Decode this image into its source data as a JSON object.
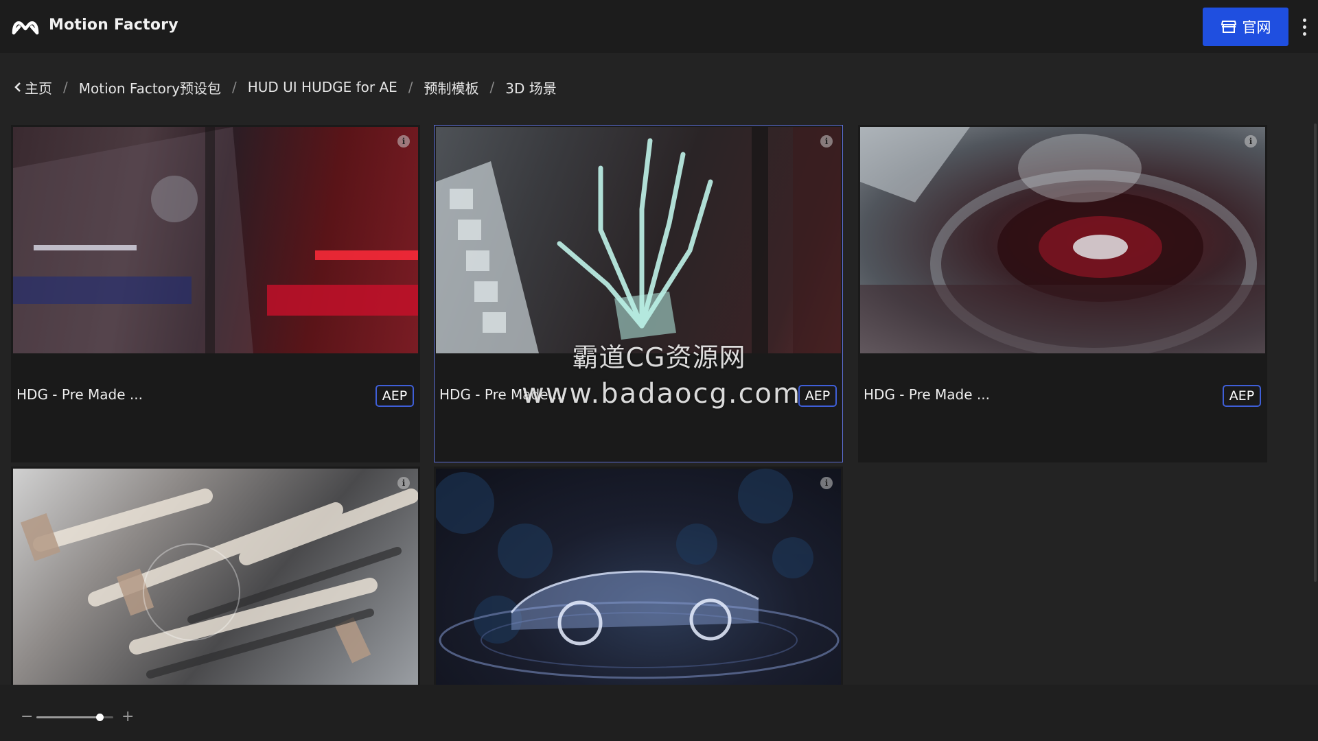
{
  "app": {
    "title": "Motion Factory",
    "logo_icon": "motion-factory-logo-icon"
  },
  "header": {
    "official_site_label": "官网",
    "official_icon": "store-icon",
    "more_icon": "more-vertical-icon"
  },
  "breadcrumb": {
    "items": [
      "主页",
      "Motion Factory预设包",
      "HUD UI HUDGE for AE",
      "预制模板",
      "3D 场景"
    ],
    "separator": "/"
  },
  "cards": [
    {
      "title": "HDG - Pre Made ...",
      "badge": "AEP",
      "info": "i"
    },
    {
      "title": "HDG - Pre Made ...",
      "badge": "AEP",
      "info": "i"
    },
    {
      "title": "HDG - Pre Made ...",
      "badge": "AEP",
      "info": "i"
    },
    {
      "title": "",
      "badge": "",
      "info": "i"
    },
    {
      "title": "",
      "badge": "",
      "info": "i"
    }
  ],
  "watermark": {
    "line1": "霸道CG资源网",
    "line2": "www.badaocg.com"
  },
  "zoom": {
    "minus": "−",
    "plus": "+",
    "level": 0.82
  },
  "colors": {
    "accent": "#1f4fe0",
    "badge_border": "#3f5fd8",
    "selected_border": "#5d6fd6"
  }
}
